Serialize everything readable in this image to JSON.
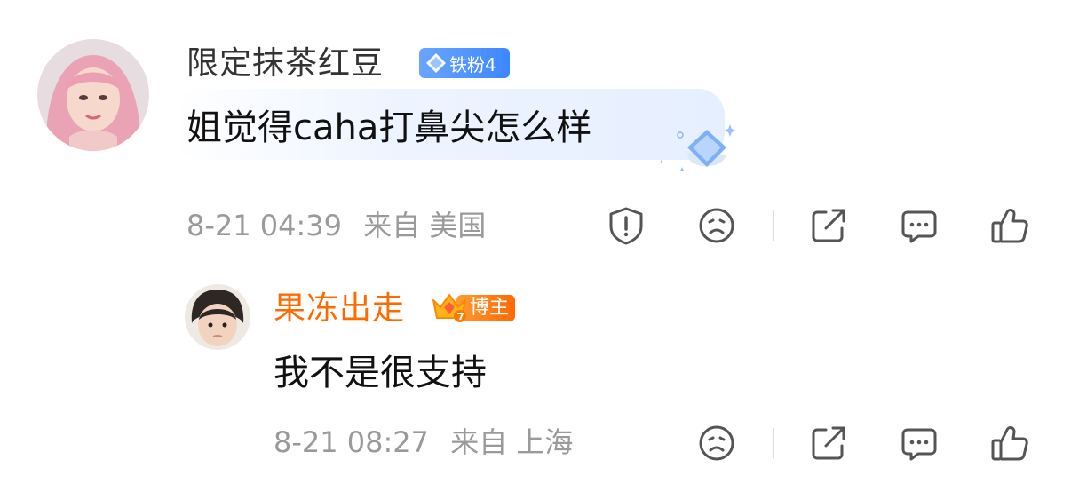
{
  "comment": {
    "username": "限定抹茶红豆",
    "fan_badge": "铁粉4",
    "text": "姐觉得caha打鼻尖怎么样",
    "time": "8-21 04:39",
    "location": "来自 美国"
  },
  "reply": {
    "username": "果冻出走",
    "role_badge": "博主",
    "text": "我不是很支持",
    "time": "8-21 08:27",
    "location": "来自 上海"
  },
  "colors": {
    "reply_username": "#ff6a00",
    "meta_text": "#9a9a9a",
    "fan_badge": "#3c86ff",
    "icon_stroke": "#555555"
  }
}
